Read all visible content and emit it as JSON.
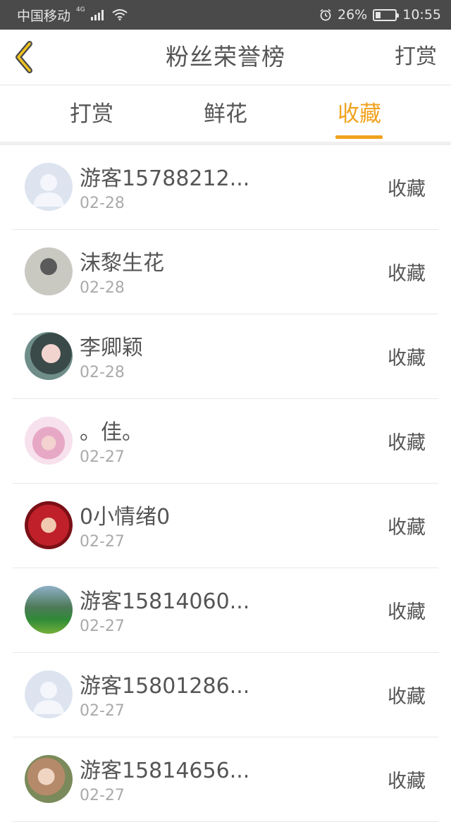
{
  "status_bar": {
    "carrier": "中国移动",
    "network": "4G",
    "battery_percent": "26%",
    "battery_level": 0.26,
    "time": "10:55",
    "icons": [
      "signal-icon",
      "wifi-icon",
      "alarm-icon",
      "battery-icon"
    ]
  },
  "header": {
    "back_icon": "chevron-left-icon",
    "title": "粉丝荣誉榜",
    "action": "打赏"
  },
  "tabs": [
    {
      "label": "打赏",
      "active": false
    },
    {
      "label": "鲜花",
      "active": false
    },
    {
      "label": "收藏",
      "active": true
    }
  ],
  "colors": {
    "accent": "#f0a21e",
    "status_bar": "#4a4a4a",
    "text": "#555555",
    "muted": "#aaaaaa"
  },
  "items": [
    {
      "name": "游客15788212...",
      "date": "02-28",
      "action": "收藏",
      "avatar": "default-avatar-icon"
    },
    {
      "name": "沫黎生花",
      "date": "02-28",
      "action": "收藏",
      "avatar": "user-avatar-photo"
    },
    {
      "name": "李卿颖",
      "date": "02-28",
      "action": "收藏",
      "avatar": "user-avatar-photo"
    },
    {
      "name": "。佳。",
      "date": "02-27",
      "action": "收藏",
      "avatar": "user-avatar-photo"
    },
    {
      "name": "0小情绪0",
      "date": "02-27",
      "action": "收藏",
      "avatar": "user-avatar-photo"
    },
    {
      "name": "游客15814060...",
      "date": "02-27",
      "action": "收藏",
      "avatar": "user-avatar-photo"
    },
    {
      "name": "游客15801286...",
      "date": "02-27",
      "action": "收藏",
      "avatar": "default-avatar-icon"
    },
    {
      "name": "游客15814656...",
      "date": "02-27",
      "action": "收藏",
      "avatar": "user-avatar-photo"
    }
  ]
}
